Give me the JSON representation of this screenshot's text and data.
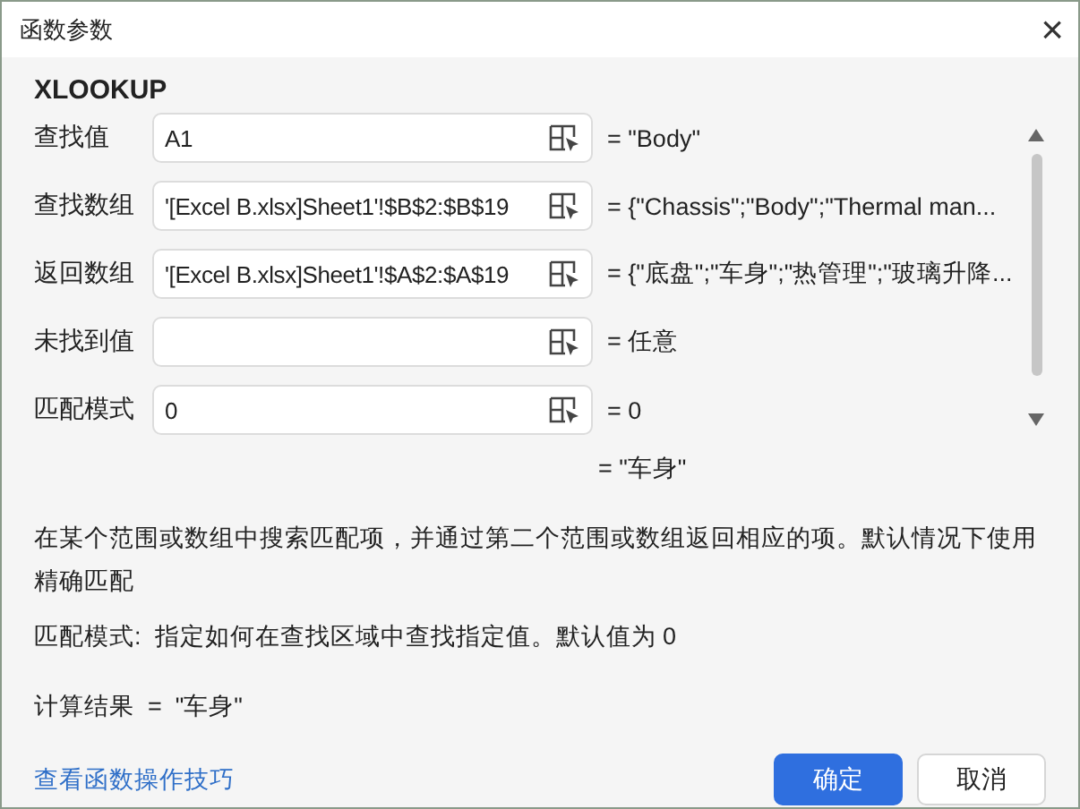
{
  "window": {
    "title": "函数参数",
    "close": "×"
  },
  "function_name": "XLOOKUP",
  "arguments": [
    {
      "label": "查找值",
      "value": "A1",
      "result": "= \"Body\""
    },
    {
      "label": "查找数组",
      "value": "'[Excel B.xlsx]Sheet1'!$B$2:$B$19",
      "result": "= {\"Chassis\";\"Body\";\"Thermal man..."
    },
    {
      "label": "返回数组",
      "value": "'[Excel B.xlsx]Sheet1'!$A$2:$A$19",
      "result": "= {\"底盘\";\"车身\";\"热管理\";\"玻璃升降..."
    },
    {
      "label": "未找到值",
      "result": "= 任意"
    },
    {
      "label": "匹配模式",
      "value": "0",
      "result": "= 0"
    }
  ],
  "function_result": "= \"车身\"",
  "description": "在某个范围或数组中搜索匹配项，并通过第二个范围或数组返回相应的项。默认情况下使用精确匹配",
  "argument_help": "匹配模式:  指定如何在查找区域中查找指定值。默认值为 0",
  "calculation_result": "计算结果  =  \"车身\"",
  "help_link": "查看函数操作技巧",
  "buttons": [
    {
      "label": "确定",
      "kind": "primary"
    },
    {
      "label": "取消",
      "kind": "secondary"
    }
  ]
}
